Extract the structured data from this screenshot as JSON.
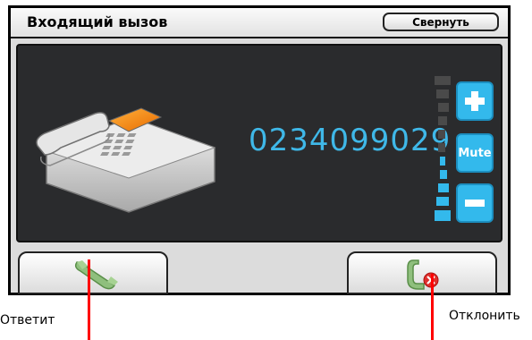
{
  "titlebar": {
    "title": "Входящий вызов",
    "minimize_label": "Свернуть"
  },
  "call": {
    "number": "0234099029"
  },
  "volume": {
    "mute_label": "Mute"
  },
  "annotations": {
    "answer": "Ответит",
    "decline": "Отклонить"
  },
  "colors": {
    "accent": "#33b9ec",
    "number": "#3fb8e8",
    "screen": "#2a2b2d",
    "callout": "#ff0000"
  }
}
